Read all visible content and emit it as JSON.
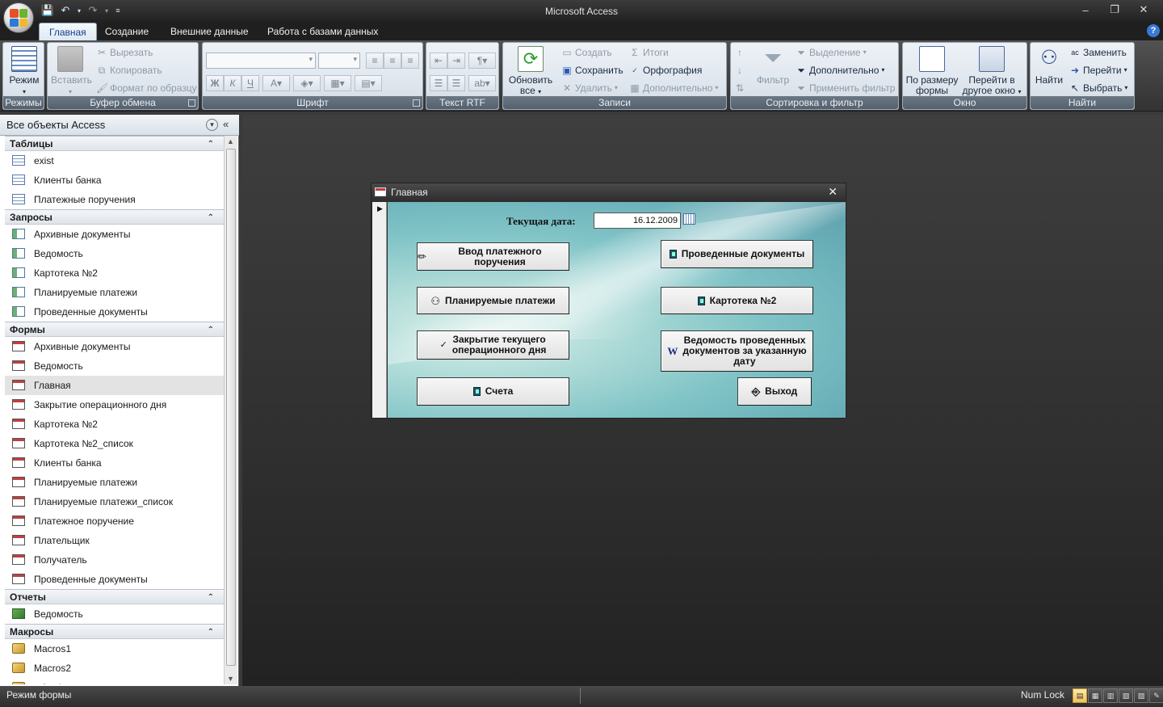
{
  "app": {
    "title": "Microsoft Access"
  },
  "ribbon": {
    "tabs": [
      "Главная",
      "Создание",
      "Внешние данные",
      "Работа с базами данных"
    ],
    "active_tab": "Главная",
    "groups": {
      "views": {
        "label": "Режимы",
        "mode_button": "Режим"
      },
      "clipboard": {
        "label": "Буфер обмена",
        "paste": "Вставить",
        "cut": "Вырезать",
        "copy": "Копировать",
        "format_painter": "Формат по образцу"
      },
      "font": {
        "label": "Шрифт",
        "bold": "Ж",
        "italic": "К",
        "underline": "Ч"
      },
      "rtf": {
        "label": "Текст RTF"
      },
      "records": {
        "label": "Записи",
        "refresh_line1": "Обновить",
        "refresh_line2": "все",
        "new": "Создать",
        "save": "Сохранить",
        "delete": "Удалить",
        "totals": "Итоги",
        "spelling": "Орфография",
        "more": "Дополнительно"
      },
      "sort_filter": {
        "label": "Сортировка и фильтр",
        "filter": "Фильтр",
        "selection": "Выделение",
        "advanced": "Дополнительно",
        "toggle_filter": "Применить фильтр"
      },
      "window": {
        "label": "Окно",
        "fit_line1": "По размеру",
        "fit_line2": "формы",
        "switch_line1": "Перейти в",
        "switch_line2": "другое окно"
      },
      "find": {
        "label": "Найти",
        "find": "Найти",
        "replace": "Заменить",
        "goto": "Перейти",
        "select": "Выбрать"
      }
    }
  },
  "navpane": {
    "title": "Все объекты Access",
    "categories": [
      {
        "name": "Таблицы",
        "type": "table",
        "items": [
          "exist",
          "Клиенты банка",
          "Платежные поручения"
        ]
      },
      {
        "name": "Запросы",
        "type": "query",
        "items": [
          "Архивные документы",
          "Ведомость",
          "Картотека №2",
          "Планируемые платежи",
          "Проведенные документы"
        ]
      },
      {
        "name": "Формы",
        "type": "form",
        "items": [
          "Архивные документы",
          "Ведомость",
          "Главная",
          "Закрытие операционного дня",
          "Картотека №2",
          "Картотека №2_список",
          "Клиенты банка",
          "Планируемые платежи",
          "Планируемые платежи_список",
          "Платежное поручение",
          "Плательщик",
          "Получатель",
          "Проведенные документы"
        ]
      },
      {
        "name": "Отчеты",
        "type": "report",
        "items": [
          "Ведомость"
        ]
      },
      {
        "name": "Макросы",
        "type": "macro",
        "items": [
          "Macros1",
          "Macros2",
          "refresh"
        ]
      }
    ],
    "selected": "Главная"
  },
  "form": {
    "title": "Главная",
    "date_label": "Текущая дата:",
    "date_value": "16.12.2009",
    "buttons": {
      "enter_payment": "Ввод платежного поручения",
      "completed_docs": "Проведенные документы",
      "planned_payments": "Планируемые платежи",
      "card_index": "Картотека №2",
      "close_day_line1": "Закрытие текущего",
      "close_day_line2": "операционного дня",
      "statement_line1": "Ведомость проведенных",
      "statement_line2": "документов за указанную",
      "statement_line3": "дату",
      "accounts": "Счета",
      "exit": "Выход"
    }
  },
  "statusbar": {
    "mode": "Режим формы",
    "numlock": "Num Lock"
  }
}
